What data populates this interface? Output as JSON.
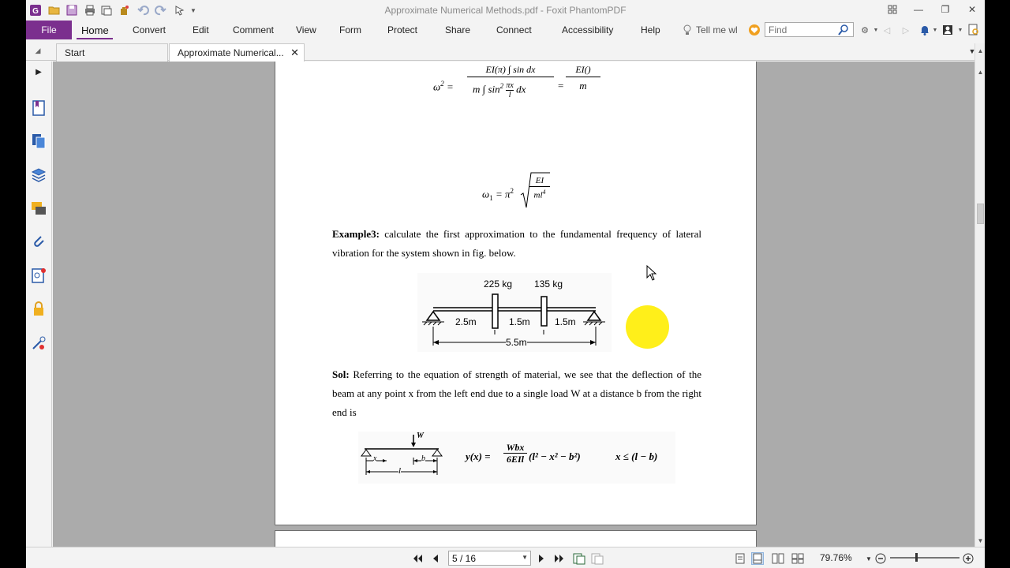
{
  "window": {
    "title": "Approximate Numerical Methods.pdf - Foxit PhantomPDF",
    "minimize": "—",
    "restore": "❐",
    "close": "✕"
  },
  "ribbon": {
    "tabs": [
      "File",
      "Home",
      "Convert",
      "Edit",
      "Comment",
      "View",
      "Form",
      "Protect",
      "Share",
      "Connect",
      "Accessibility",
      "Help"
    ],
    "tell_me": "Tell me wl",
    "find_placeholder": "Find"
  },
  "doc_tabs": {
    "start": "Start",
    "active": "Approximate Numerical...",
    "close": "✕"
  },
  "document": {
    "eq_top": {
      "lhs": "ω",
      "lhs_sup": "2",
      "num1_part": "EI(",
      "num1_frac": "π",
      "num1_rest": ") ∫ sin",
      "num1_dx": "dx",
      "den1": "m ∫ sin",
      "den1_sup": "2",
      "den1_frac_num": "πx",
      "den1_frac_den": "l",
      "den1_dx": "dx",
      "num2": "EI(",
      "num2_rest": ")",
      "den2": "m"
    },
    "eq_omega1": {
      "lhs": "ω",
      "lhs_sub": "1",
      "eq": "= π",
      "pi_sup": "2",
      "frac_num": "EI",
      "frac_den": "ml",
      "frac_den_sup": "4"
    },
    "example_label": "Example3:",
    "example_text": " calculate the first approximation to the fundamental frequency of lateral vibration for the system shown in fig. below.",
    "fig1": {
      "load1": "225 kg",
      "load2": "135 kg",
      "seg1": "2.5m",
      "seg2": "1.5m",
      "seg3": "1.5m",
      "total": "5.5m"
    },
    "sol_label": "Sol:",
    "sol_text": " Referring to the equation of strength of material, we see that the deflection of the beam at any point x from the left end due to a single load W at a distance b from the right end is",
    "fig2": {
      "load": "W",
      "x": "x",
      "b": "b",
      "l": "l"
    },
    "deflection_eq": {
      "lhs": "y(x) =",
      "frac_num": "Wbx",
      "frac_den": "6EIl",
      "rhs": "(l² − x² − b²)",
      "cond": "x ≤ (l − b)"
    }
  },
  "status": {
    "page_indicator": "5 / 16",
    "zoom": "79.76%"
  },
  "colors": {
    "file_tab": "#7b2f8e",
    "cursor_highlight": "#ffef1a",
    "doc_bg": "#ababab"
  }
}
